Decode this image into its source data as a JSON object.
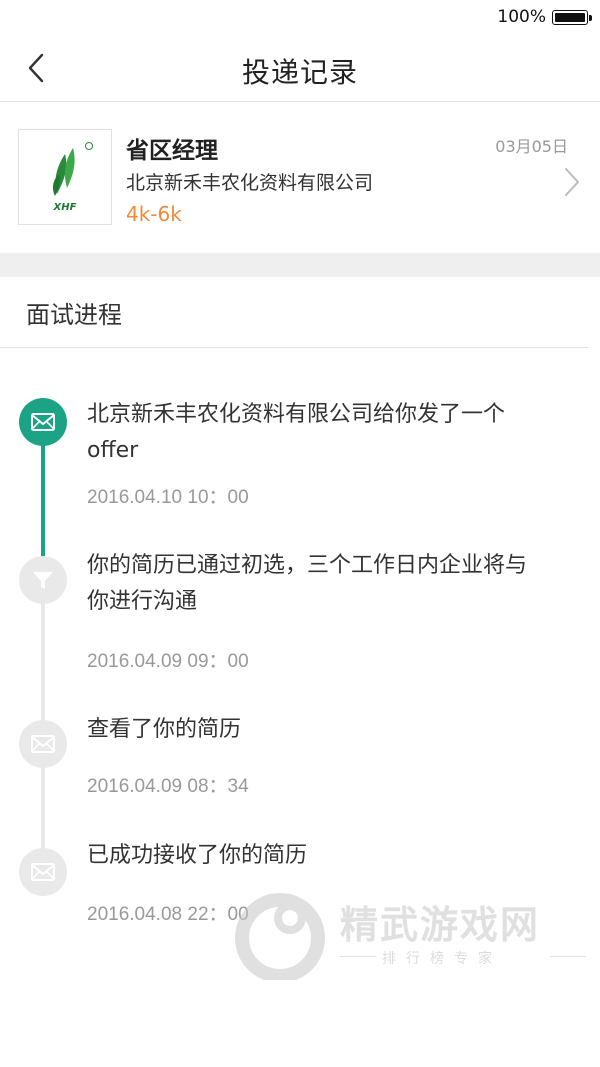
{
  "status_bar": {
    "battery_percent": "100%"
  },
  "nav": {
    "title": "投递记录"
  },
  "job": {
    "title": "省区经理",
    "company": "北京新禾丰农化资料有限公司",
    "salary": "4k-6k",
    "date": "03月05日",
    "logo_text": "XHF",
    "salary_color": "#f08a3a"
  },
  "section": {
    "title": "面试进程"
  },
  "timeline": {
    "accent_color": "#1aa384",
    "events": [
      {
        "text_line1": "北京新禾丰农化资料有限公司给你发了一个",
        "text_line2": "offer",
        "time": "2016.04.10   10：00",
        "icon": "envelope-icon",
        "active": true
      },
      {
        "text_line1": "你的简历已通过初选，三个工作日内企业将与",
        "text_line2": "你进行沟通",
        "time": "2016.04.09   09：00",
        "icon": "filter-icon",
        "active": false
      },
      {
        "text_line1": "查看了你的简历",
        "text_line2": "",
        "time": "2016.04.09   08：34",
        "icon": "envelope-icon",
        "active": false
      },
      {
        "text_line1": "已成功接收了你的简历",
        "text_line2": "",
        "time": "2016.04.08   22：00",
        "icon": "envelope-icon",
        "active": false
      }
    ]
  },
  "watermark": {
    "name": "精武游戏网",
    "subtitle": "排行榜专家"
  }
}
